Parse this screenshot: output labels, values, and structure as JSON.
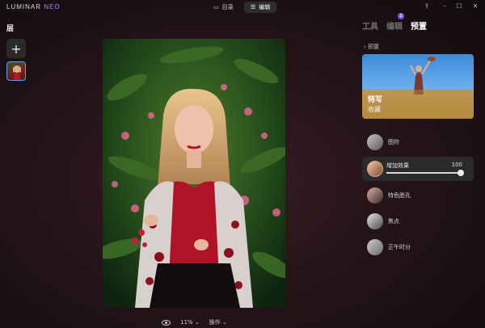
{
  "app": {
    "logo_main": "LUMINAR ",
    "logo_accent": "NEO"
  },
  "topbar": {
    "catalog_label": "目录",
    "edit_label": "编辑"
  },
  "layers": {
    "title": "层",
    "add_label": "+"
  },
  "bottombar": {
    "zoom": "11%",
    "actions_label": "操作"
  },
  "right_panel": {
    "tabs": [
      {
        "label": "工具",
        "active": false
      },
      {
        "label": "编辑",
        "active": false,
        "badge": "1"
      },
      {
        "label": "预置",
        "active": true
      }
    ],
    "back_label": "预置",
    "hero": {
      "title": "特写",
      "subtitle": "收藏"
    },
    "presets": [
      {
        "label": "图符"
      },
      {
        "label": "增加效果",
        "amount": 100
      },
      {
        "label": "特色脸孔"
      },
      {
        "label": "焦点"
      },
      {
        "label": "正午时分"
      }
    ]
  }
}
